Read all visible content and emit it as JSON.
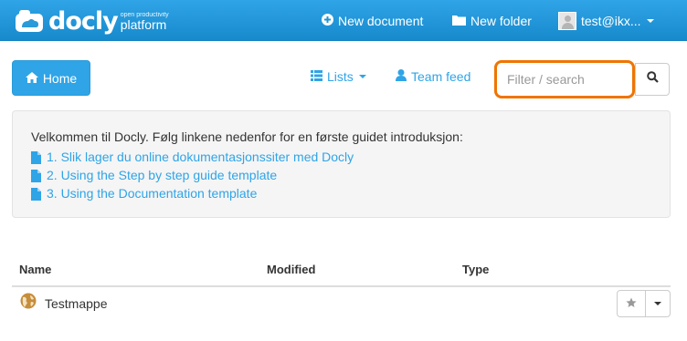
{
  "header": {
    "logo_word": "docly",
    "logo_tagline_small": "open productivity",
    "logo_tagline_big": "platform",
    "new_document": "New document",
    "new_folder": "New folder",
    "user": "test@ikx..."
  },
  "toolbar": {
    "home": "Home",
    "lists": "Lists",
    "team_feed": "Team feed",
    "search_placeholder": "Filter / search"
  },
  "welcome": {
    "intro": "Velkommen til Docly. Følg linkene nedenfor for en første guidet introduksjon:",
    "links": [
      "1. Slik lager du online dokumentasjonssiter med Docly",
      "2. Using the Step by step guide template",
      "3. Using the Documentation template"
    ]
  },
  "table": {
    "columns": [
      "Name",
      "Modified",
      "Type"
    ],
    "rows": [
      {
        "name": "Testmappe",
        "modified": "",
        "type": ""
      }
    ]
  },
  "colors": {
    "brand": "#2fa4e7",
    "highlight": "#f07400"
  },
  "icons": [
    "cloud-icon",
    "plus-circle-icon",
    "folder-icon",
    "avatar",
    "home-icon",
    "list-icon",
    "user-icon",
    "search-icon",
    "document-icon",
    "globe-icon",
    "star-icon",
    "caret-down-icon"
  ]
}
